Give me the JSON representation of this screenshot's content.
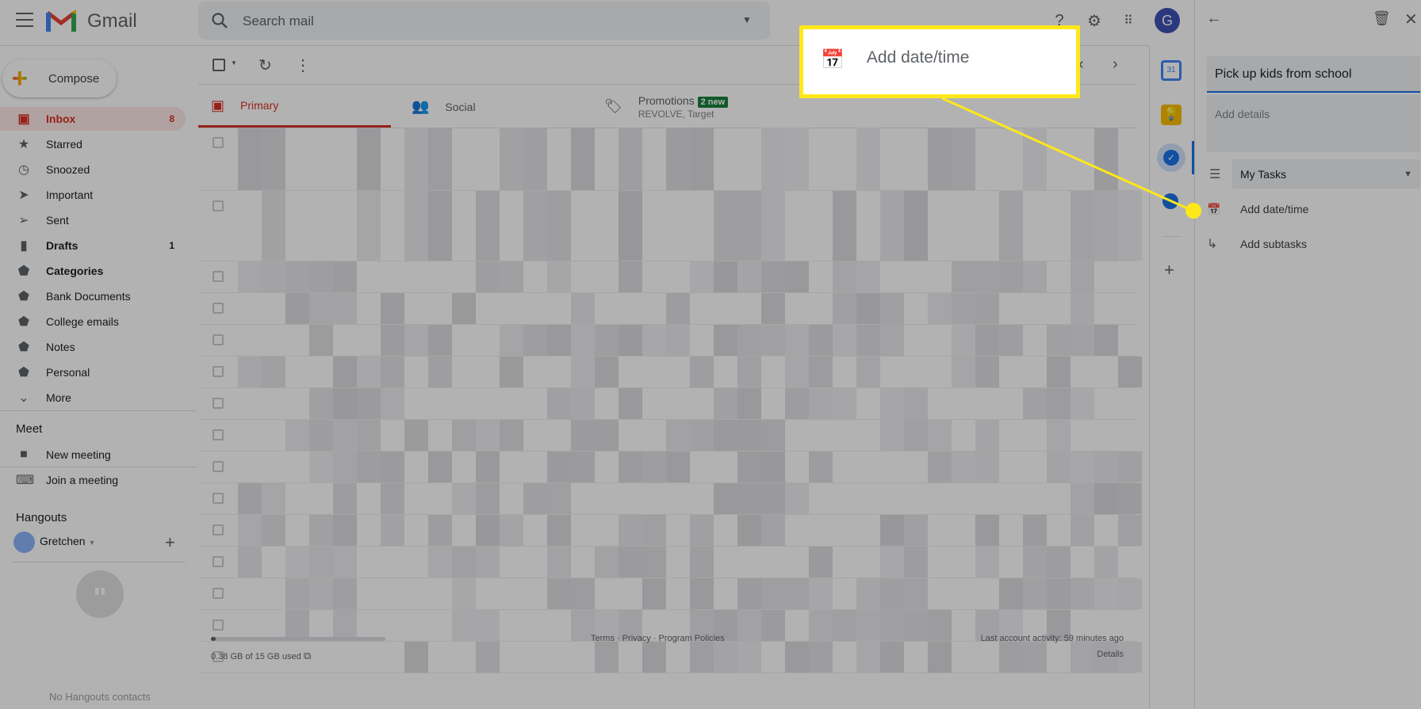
{
  "header": {
    "app_name": "Gmail",
    "search_placeholder": "Search mail",
    "avatar_initial": "G"
  },
  "compose_label": "Compose",
  "sidebar": {
    "items": [
      {
        "label": "Inbox",
        "count": "8",
        "icon": "inbox-icon",
        "active": true
      },
      {
        "label": "Starred",
        "icon": "star-icon"
      },
      {
        "label": "Snoozed",
        "icon": "clock-icon"
      },
      {
        "label": "Important",
        "icon": "important-icon"
      },
      {
        "label": "Sent",
        "icon": "send-icon"
      },
      {
        "label": "Drafts",
        "count": "1",
        "icon": "draft-icon",
        "bold": true
      },
      {
        "label": "Categories",
        "icon": "label-icon",
        "bold": true
      },
      {
        "label": "Bank Documents",
        "icon": "label-icon"
      },
      {
        "label": "College emails",
        "icon": "label-icon"
      },
      {
        "label": "Notes",
        "icon": "label-icon"
      },
      {
        "label": "Personal",
        "icon": "label-icon"
      },
      {
        "label": "More",
        "icon": "chevron-down-icon"
      }
    ],
    "meet": {
      "title": "Meet",
      "new_meeting": "New meeting",
      "join_meeting": "Join a meeting"
    },
    "hangouts": {
      "title": "Hangouts",
      "user": "Gretchen",
      "empty": "No Hangouts contacts"
    }
  },
  "tabs": [
    {
      "label": "Primary"
    },
    {
      "label": "Social"
    },
    {
      "label": "Promotions",
      "badge": "2 new",
      "sub": "REVOLVE, Target"
    }
  ],
  "footer": {
    "storage": "0.38 GB of 15 GB used",
    "storage_fraction": 0.025,
    "links": "Terms · Privacy · Program Policies",
    "activity": "Last account activity: 59 minutes ago",
    "details": "Details"
  },
  "task_panel": {
    "title": "Pick up kids from school",
    "details_placeholder": "Add details",
    "list": "My Tasks",
    "add_date": "Add date/time",
    "add_subtasks": "Add subtasks"
  },
  "callout": {
    "label": "Add date/time",
    "color": "#ffe81a"
  },
  "colors": {
    "accent": "#d93025",
    "tasks": "#1a73e8",
    "badge": "#188038"
  }
}
